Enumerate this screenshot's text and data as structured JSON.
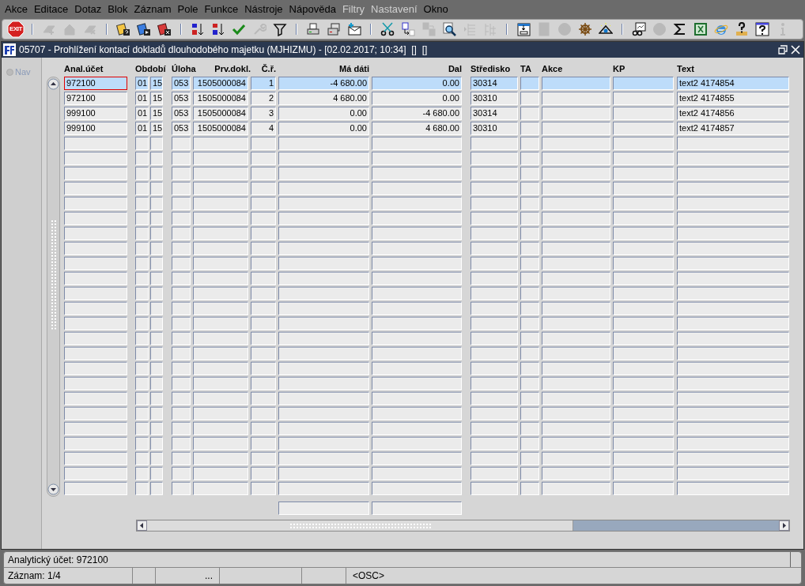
{
  "menu": [
    {
      "label": "Akce",
      "disabled": false
    },
    {
      "label": "Editace",
      "disabled": false
    },
    {
      "label": "Dotaz",
      "disabled": false
    },
    {
      "label": "Blok",
      "disabled": false
    },
    {
      "label": "Záznam",
      "disabled": false
    },
    {
      "label": "Pole",
      "disabled": false
    },
    {
      "label": "Funkce",
      "disabled": false
    },
    {
      "label": "Nástroje",
      "disabled": false
    },
    {
      "label": "Nápověda",
      "disabled": false
    },
    {
      "label": "Filtry",
      "disabled": true
    },
    {
      "label": "Nastavení",
      "disabled": true
    },
    {
      "label": "Okno",
      "disabled": false
    }
  ],
  "toolbar": [
    {
      "kind": "exit",
      "label": "EXIT"
    },
    {
      "kind": "separator"
    },
    {
      "kind": "button",
      "disabled": true
    },
    {
      "kind": "button",
      "disabled": true
    },
    {
      "kind": "button",
      "disabled": true
    },
    {
      "kind": "separator"
    },
    {
      "kind": "button",
      "disabled": false
    },
    {
      "kind": "button",
      "disabled": false
    },
    {
      "kind": "button",
      "disabled": false
    },
    {
      "kind": "separator"
    },
    {
      "kind": "button",
      "disabled": false
    },
    {
      "kind": "button",
      "disabled": false
    },
    {
      "kind": "button",
      "disabled": false
    },
    {
      "kind": "button",
      "disabled": true
    },
    {
      "kind": "button",
      "disabled": false
    },
    {
      "kind": "separator"
    },
    {
      "kind": "button",
      "disabled": false
    },
    {
      "kind": "button",
      "disabled": false
    },
    {
      "kind": "button",
      "disabled": false
    },
    {
      "kind": "separator"
    },
    {
      "kind": "button",
      "disabled": false
    },
    {
      "kind": "button",
      "disabled": false
    },
    {
      "kind": "button",
      "disabled": true
    },
    {
      "kind": "button",
      "disabled": false
    },
    {
      "kind": "button",
      "disabled": true
    },
    {
      "kind": "button",
      "disabled": true
    },
    {
      "kind": "separator"
    },
    {
      "kind": "button",
      "disabled": false
    },
    {
      "kind": "button",
      "disabled": true
    },
    {
      "kind": "button",
      "disabled": true
    },
    {
      "kind": "button",
      "disabled": false
    },
    {
      "kind": "button",
      "disabled": false
    },
    {
      "kind": "separator"
    },
    {
      "kind": "button",
      "disabled": false
    },
    {
      "kind": "button",
      "disabled": true
    },
    {
      "kind": "button",
      "disabled": false
    },
    {
      "kind": "button",
      "disabled": false
    },
    {
      "kind": "button",
      "disabled": false
    },
    {
      "kind": "button",
      "disabled": false
    },
    {
      "kind": "button",
      "disabled": false
    },
    {
      "kind": "button",
      "disabled": true
    }
  ],
  "window": {
    "title": "05707 - Prohlížení kontací dokladů dlouhodobého majetku (MJHIZMU) - [02.02.2017; 10:34]  []  []"
  },
  "nav": {
    "label": "Nav",
    "disabled": true,
    "selected": false
  },
  "table": {
    "columns": [
      "Anal.účet",
      "Období",
      "",
      "Úloha",
      "Prv.dokl.",
      "Č.ř.",
      "Má dáti",
      "Dal",
      "Středisko",
      "TA",
      "Akce",
      "KP",
      "Text"
    ],
    "rows": [
      {
        "selected": true,
        "cells": [
          "972100",
          "01",
          "15",
          "053",
          "1505000084",
          "1",
          "-4 680.00",
          "0.00",
          "30314",
          "",
          "",
          "",
          "text2 4174854"
        ]
      },
      {
        "selected": false,
        "cells": [
          "972100",
          "01",
          "15",
          "053",
          "1505000084",
          "2",
          "4 680.00",
          "0.00",
          "30310",
          "",
          "",
          "",
          "text2 4174855"
        ]
      },
      {
        "selected": false,
        "cells": [
          "999100",
          "01",
          "15",
          "053",
          "1505000084",
          "3",
          "0.00",
          "-4 680.00",
          "30314",
          "",
          "",
          "",
          "text2 4174856"
        ]
      },
      {
        "selected": false,
        "cells": [
          "999100",
          "01",
          "15",
          "053",
          "1505000084",
          "4",
          "0.00",
          "4 680.00",
          "30310",
          "",
          "",
          "",
          "text2 4174857"
        ]
      }
    ]
  },
  "status": {
    "hint": "Analytický účet: 972100",
    "record": "Záznam: 1/4",
    "field_3": "...",
    "mode": "<OSC>"
  }
}
